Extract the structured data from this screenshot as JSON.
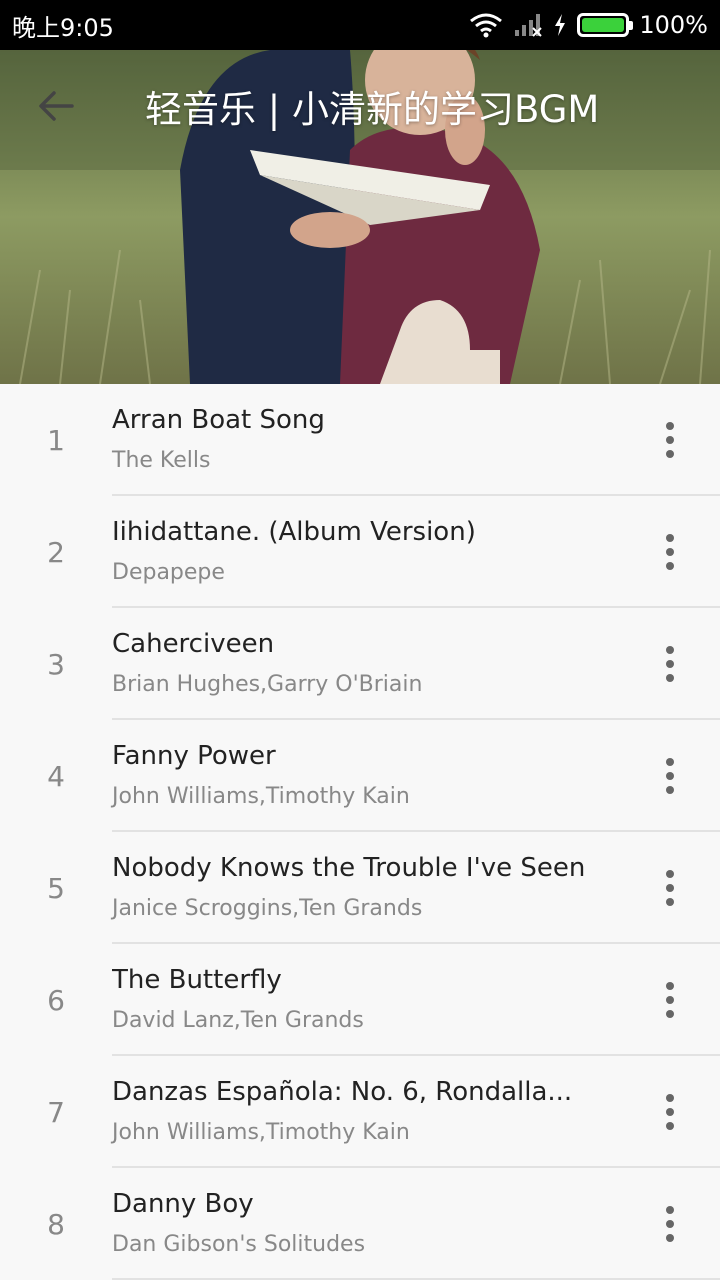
{
  "status_bar": {
    "time": "晚上9:05",
    "battery": "100%"
  },
  "header": {
    "title": "轻音乐 | 小清新的学习BGM"
  },
  "songs": [
    {
      "index": "1",
      "title": "Arran Boat Song",
      "artist": "The Kells"
    },
    {
      "index": "2",
      "title": "Iihidattane. (Album Version)",
      "artist": "Depapepe"
    },
    {
      "index": "3",
      "title": "Caherciveen",
      "artist": "Brian Hughes,Garry O'Briain"
    },
    {
      "index": "4",
      "title": "Fanny Power",
      "artist": "John Williams,Timothy Kain"
    },
    {
      "index": "5",
      "title": "Nobody Knows the Trouble I've Seen",
      "artist": "Janice Scroggins,Ten Grands"
    },
    {
      "index": "6",
      "title": "The Butterfly",
      "artist": "David Lanz,Ten Grands"
    },
    {
      "index": "7",
      "title": "Danzas Española: No. 6, Rondalla...",
      "artist": "John Williams,Timothy Kain"
    },
    {
      "index": "8",
      "title": "Danny Boy",
      "artist": "Dan Gibson's Solitudes"
    }
  ],
  "colors": {
    "battery_fill": "#3bd13b",
    "list_background": "#f8f8f8"
  }
}
